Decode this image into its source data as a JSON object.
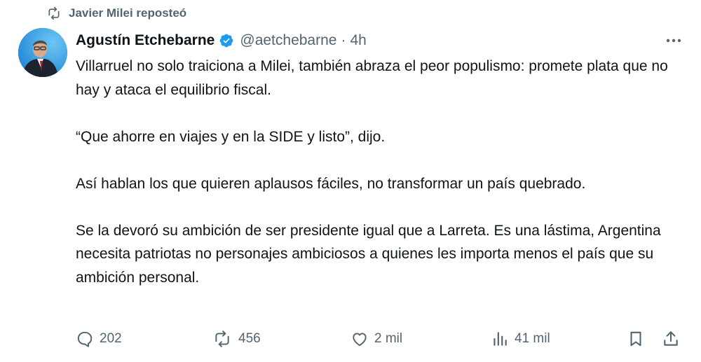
{
  "repost": {
    "text": "Javier Milei reposteó",
    "icon": "repost-icon"
  },
  "author": {
    "display_name": "Agustín Etchebarne",
    "verified_icon": "verified-badge-icon",
    "verified_color": "#1d9bf0",
    "handle": "@aetchebarne",
    "separator": "·",
    "time": "4h"
  },
  "tweet": {
    "paragraphs": [
      "Villarruel no solo traiciona a Milei, también abraza el peor populismo: promete plata que no hay y ataca el equilibrio fiscal.",
      "“Que ahorre en viajes y en la SIDE y listo”, dijo.",
      "Así hablan los que quieren aplausos fáciles, no transformar un país quebrado.",
      "Se la devoró su ambición de ser presidente igual que a Larreta. Es una lástima, Argentina necesita patriotas no personajes ambiciosos a quienes les importa menos el país que su ambición personal."
    ]
  },
  "actions": {
    "replies": {
      "count": "202",
      "icon": "reply-icon"
    },
    "reposts": {
      "count": "456",
      "icon": "repost-icon"
    },
    "likes": {
      "count": "2 mil",
      "icon": "heart-icon"
    },
    "views": {
      "count": "41 mil",
      "icon": "views-icon"
    },
    "bookmark": {
      "icon": "bookmark-icon"
    },
    "share": {
      "icon": "share-icon"
    }
  },
  "colors": {
    "text": "#0f1419",
    "secondary": "#536471",
    "accent": "#1d9bf0"
  }
}
